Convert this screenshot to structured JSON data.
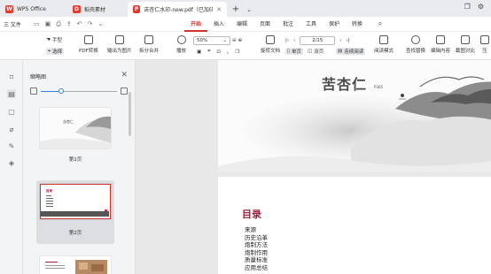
{
  "tabs": [
    {
      "label": "WPS Office"
    },
    {
      "label": "稻壳素材"
    },
    {
      "label": "苦杏仁水印-new.pdf（已加印）"
    }
  ],
  "menu": {
    "file_label": "三 文件",
    "ribbon_tabs": [
      "开始",
      "插入",
      "编辑",
      "页面",
      "批注",
      "工具",
      "保护",
      "转换"
    ],
    "active_tab": "开始"
  },
  "toolbar": {
    "hand": "手型",
    "select": "选择",
    "pdf_convert": "PDF转换",
    "export_image": "输出为图片",
    "split_merge": "拆分合并",
    "play": "播放",
    "zoom": "50%",
    "page_value": "2/15",
    "rotate": "旋转文档",
    "single_page": "单页",
    "double_page": "双页",
    "continuous": "连续阅读",
    "read_mode": "阅读模式",
    "find_replace": "查找替换",
    "edit_content": "编辑内容",
    "screenshot_compare": "截图对比",
    "compress": "压"
  },
  "thumbnail_panel": {
    "title": "缩略图",
    "pages": [
      {
        "caption": "第1页",
        "mini_title": "苦杏仁"
      },
      {
        "caption": "第2页",
        "mini_title": "目录"
      },
      {
        "caption": ""
      }
    ]
  },
  "document": {
    "cover_title": "苦杏仁",
    "cover_sub": "P365",
    "toc_title": "目录",
    "toc_items": [
      "来源",
      "历史沿革",
      "炮制方法",
      "炮制作用",
      "质量标准",
      "应用总结"
    ]
  },
  "colors": {
    "accent": "#d0342c",
    "toc_title": "#9c1f3c"
  }
}
